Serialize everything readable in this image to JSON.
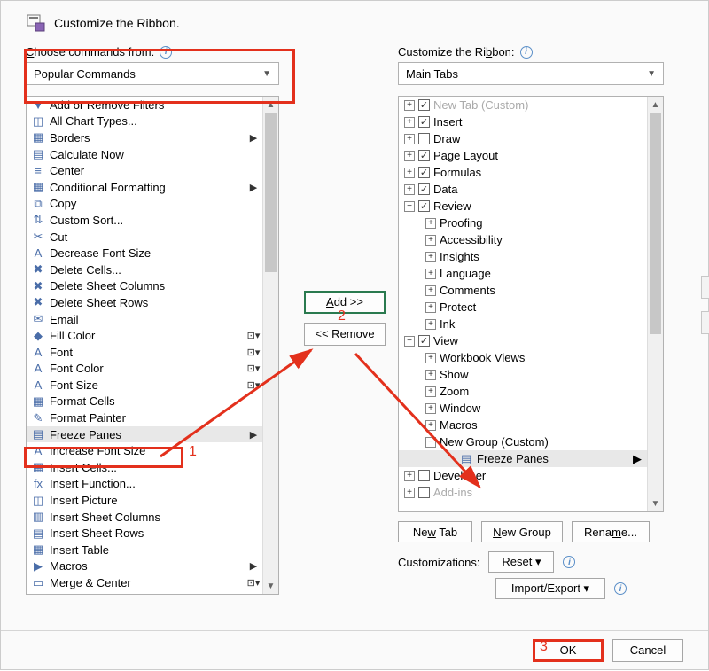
{
  "header": {
    "title": "Customize the Ribbon."
  },
  "left": {
    "label": "Choose commands from:",
    "combo": "Popular Commands",
    "items": [
      {
        "icon": "filter",
        "label": "Add or Remove Filters"
      },
      {
        "icon": "chart",
        "label": "All Chart Types..."
      },
      {
        "icon": "borders",
        "label": "Borders",
        "sub": "▶"
      },
      {
        "icon": "calc",
        "label": "Calculate Now"
      },
      {
        "icon": "center",
        "label": "Center"
      },
      {
        "icon": "condfmt",
        "label": "Conditional Formatting",
        "sub": "▶"
      },
      {
        "icon": "copy",
        "label": "Copy"
      },
      {
        "icon": "sort",
        "label": "Custom Sort..."
      },
      {
        "icon": "cut",
        "label": "Cut"
      },
      {
        "icon": "fontdown",
        "label": "Decrease Font Size"
      },
      {
        "icon": "delcells",
        "label": "Delete Cells..."
      },
      {
        "icon": "delcol",
        "label": "Delete Sheet Columns"
      },
      {
        "icon": "delrow",
        "label": "Delete Sheet Rows"
      },
      {
        "icon": "email",
        "label": "Email"
      },
      {
        "icon": "fill",
        "label": "Fill Color",
        "sub": "⊡▾"
      },
      {
        "icon": "font",
        "label": "Font",
        "sub": "⊡▾"
      },
      {
        "icon": "fontcolor",
        "label": "Font Color",
        "sub": "⊡▾"
      },
      {
        "icon": "fontsize",
        "label": "Font Size",
        "sub": "⊡▾"
      },
      {
        "icon": "fmtcells",
        "label": "Format Cells"
      },
      {
        "icon": "painter",
        "label": "Format Painter"
      },
      {
        "icon": "freeze",
        "label": "Freeze Panes",
        "sub": "▶",
        "sel": true
      },
      {
        "icon": "fontup",
        "label": "Increase Font Size"
      },
      {
        "icon": "inscells",
        "label": "Insert Cells..."
      },
      {
        "icon": "fx",
        "label": "Insert Function..."
      },
      {
        "icon": "pic",
        "label": "Insert Picture"
      },
      {
        "icon": "inscol",
        "label": "Insert Sheet Columns"
      },
      {
        "icon": "insrow",
        "label": "Insert Sheet Rows"
      },
      {
        "icon": "table",
        "label": "Insert Table"
      },
      {
        "icon": "macros",
        "label": "Macros",
        "sub": "▶"
      },
      {
        "icon": "merge",
        "label": "Merge & Center",
        "sub": "⊡▾"
      }
    ]
  },
  "mid": {
    "add": "Add >>",
    "remove": "<< Remove"
  },
  "right": {
    "label": "Customize the Ribbon:",
    "combo": "Main Tabs",
    "tree": [
      {
        "indent": 0,
        "exp": "+",
        "check": true,
        "label": "New Tab (Custom)",
        "dim": true
      },
      {
        "indent": 0,
        "exp": "+",
        "check": true,
        "label": "Insert"
      },
      {
        "indent": 0,
        "exp": "+",
        "check": false,
        "label": "Draw"
      },
      {
        "indent": 0,
        "exp": "+",
        "check": true,
        "label": "Page Layout"
      },
      {
        "indent": 0,
        "exp": "+",
        "check": true,
        "label": "Formulas"
      },
      {
        "indent": 0,
        "exp": "+",
        "check": true,
        "label": "Data"
      },
      {
        "indent": 0,
        "exp": "−",
        "check": true,
        "label": "Review"
      },
      {
        "indent": 1,
        "exp": "+",
        "label": "Proofing"
      },
      {
        "indent": 1,
        "exp": "+",
        "label": "Accessibility"
      },
      {
        "indent": 1,
        "exp": "+",
        "label": "Insights"
      },
      {
        "indent": 1,
        "exp": "+",
        "label": "Language"
      },
      {
        "indent": 1,
        "exp": "+",
        "label": "Comments"
      },
      {
        "indent": 1,
        "exp": "+",
        "label": "Protect"
      },
      {
        "indent": 1,
        "exp": "+",
        "label": "Ink"
      },
      {
        "indent": 0,
        "exp": "−",
        "check": true,
        "label": "View"
      },
      {
        "indent": 1,
        "exp": "+",
        "label": "Workbook Views"
      },
      {
        "indent": 1,
        "exp": "+",
        "label": "Show"
      },
      {
        "indent": 1,
        "exp": "+",
        "label": "Zoom"
      },
      {
        "indent": 1,
        "exp": "+",
        "label": "Window"
      },
      {
        "indent": 1,
        "exp": "+",
        "label": "Macros"
      },
      {
        "indent": 1,
        "exp": "−",
        "label": "New Group (Custom)"
      },
      {
        "indent": 2,
        "icon": "freeze",
        "label": "Freeze Panes",
        "sub": "▶",
        "sel": true
      },
      {
        "indent": 0,
        "exp": "+",
        "check": false,
        "label": "Developer"
      },
      {
        "indent": 0,
        "exp": "+",
        "check": false,
        "label": "Add-ins",
        "dim": true
      }
    ],
    "newtab": "New Tab",
    "newgroup": "New Group",
    "rename": "Rename...",
    "cust_label": "Customizations:",
    "reset": "Reset ▾",
    "import": "Import/Export ▾"
  },
  "footer": {
    "ok": "OK",
    "cancel": "Cancel"
  },
  "annotations": {
    "a1": "1",
    "a2": "2",
    "a3": "3"
  }
}
